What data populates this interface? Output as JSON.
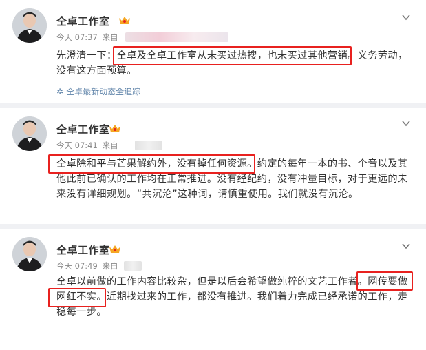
{
  "posts": [
    {
      "author": "仝卓工作室",
      "time": "今天 07:37",
      "from": "来自",
      "text_lines": [
        "先澄清一下：仝卓及仝卓工作室从未买过热搜，也未买过其他营销。义务劳动，",
        "没有这方面预算。"
      ],
      "source": "仝卓最新动态全追踪"
    },
    {
      "author": "仝卓工作室",
      "time": "今天 07:41",
      "from": "来自",
      "text_lines": [
        "仝卓除和平与芒果解约外，没有掉任何资源。约定的每年一本的书、个音以及其",
        "他此前已确认的工作均在正常推进。没有经纪约，没有冲量目标，对于更远的未",
        "来没有详细规划。“共沉沦”这种词，请慎重使用。我们就没有沉沦。"
      ]
    },
    {
      "author": "仝卓工作室",
      "time": "今天 07:49",
      "from": "来自",
      "text_lines": [
        "仝卓以前做的工作内容比较杂，但是以后会希望做纯粹的文艺工作者。网传要做",
        "网红不实。近期找过来的工作，都没有推进。我们着力完成已经承诺的工作，走",
        "稳每一步。"
      ]
    }
  ],
  "icons": {
    "vip": "vip-crown-icon",
    "more": "chevron-down-icon",
    "source": "sparkle-icon"
  },
  "colors": {
    "highlight": "#e8211f",
    "link": "#5d82a8",
    "vip": "#f5a623"
  }
}
